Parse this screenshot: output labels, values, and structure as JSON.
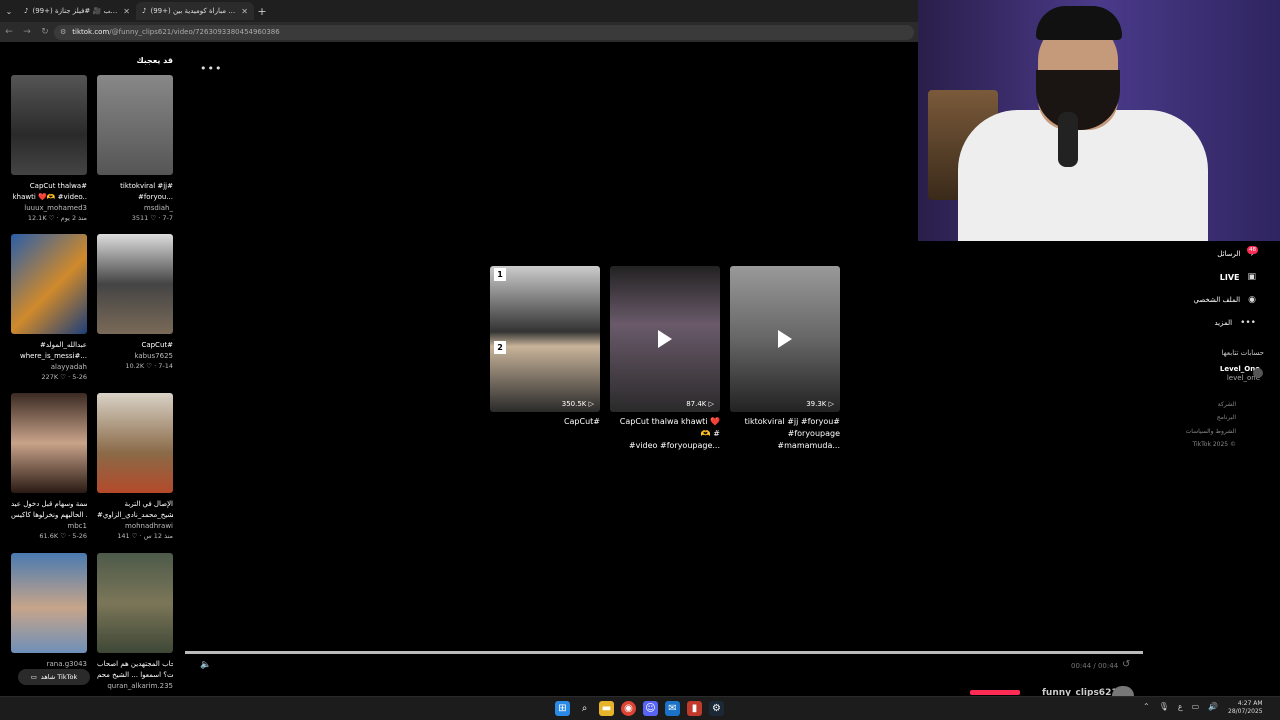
{
  "browser": {
    "tabs": [
      {
        "label": "(99+) هو طلب 🎥 #فيلز جنازة",
        "active": false
      },
      {
        "label": "(99+) اجمل مباراة كوميدية بين",
        "active": true
      }
    ],
    "url_host": "tiktok.com",
    "url_path": "/@funny_clips621/video/7263093380454960386"
  },
  "sidebar": {
    "title": "قد يعجبك",
    "items": [
      {
        "caption": "CapCut thalwa#",
        "caption2": "khawti ❤️🫶 #video..",
        "user": "luuux_mohamed3",
        "meta": "12.1K ♡ · منذ 2 يوم"
      },
      {
        "caption": "tiktokviral #jj#",
        "caption2": "#foryou...",
        "user": "msdiah_",
        "meta": "3511 ♡ · 7-7"
      },
      {
        "caption": "#عبدالله_المولد",
        "caption2": "where_is_messi#...",
        "user": "alayyadah",
        "meta": "227K ♡ · 5-26"
      },
      {
        "caption": "CapCut#",
        "caption2": "",
        "user": "kabus7625",
        "meta": "10.2K ♡ · 7-14"
      },
      {
        "caption": "بسمة وسهام قبل دخول عيد",
        "caption2": "الحاليهم ونخرلوها كاكيس ...",
        "user": "mbc1",
        "meta": "61.6K ♡ · 5-26"
      },
      {
        "caption": "الإصال في التربة",
        "caption2": "#الشيخ_محمد_نادي_الزاوي...",
        "user": "mohnadhrawi",
        "meta": "141 ♡ · منذ 12 س"
      },
      {
        "caption": "",
        "caption2": "",
        "user": "rana.g3043",
        "meta": ""
      },
      {
        "caption": "اسحاب المجتهدين هم اصحاب",
        "caption2": "السبت؟ اسمعوا ... الشيخ محم...",
        "user": "quran_alkarim.235",
        "meta": ""
      }
    ],
    "watch_button": "شاهد TikTok"
  },
  "videos": [
    {
      "views": "350.5K",
      "caption1": "CapCut#",
      "caption2": ""
    },
    {
      "views": "87.4K",
      "caption1": "CapCut thalwa khawti ❤️🫶 #",
      "caption2": "#video #foryoupage..."
    },
    {
      "views": "39.3K",
      "caption1": "tiktokviral #jj #foryou#",
      "caption2": "#foryoupage #mamamuda..."
    }
  ],
  "player": {
    "time": "00:44 / 00:44",
    "progress": 1.0,
    "author": "funny_clips621"
  },
  "rightnav": {
    "messages": "الرسائل",
    "messages_badge": "48",
    "live": "LIVE",
    "profile": "الملف الشخصي",
    "more": "المزيد",
    "following_title": "حسابات تتابعها",
    "account_name": "Level_One",
    "account_handle": "level_one",
    "footer": [
      "الشركة",
      "البرنامج",
      "الشروط والسياسات",
      "TikTok 2025 ©"
    ]
  },
  "taskbar": {
    "lang": "ع",
    "time": "4:27 AM",
    "date": "28/07/2025"
  },
  "colors": {
    "accent": "#fe2c55",
    "background": "#000000"
  }
}
